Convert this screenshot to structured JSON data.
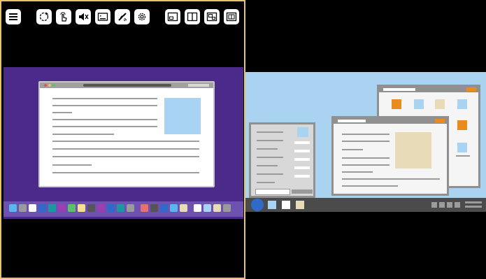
{
  "toolbar": {
    "buttons": [
      {
        "name": "menu",
        "icon": "menu-icon"
      },
      {
        "name": "refresh",
        "icon": "refresh-icon"
      },
      {
        "name": "touch",
        "icon": "touch-icon"
      },
      {
        "name": "mute",
        "icon": "mute-icon"
      },
      {
        "name": "keyboard",
        "icon": "keyboard-icon"
      },
      {
        "name": "disconnect",
        "icon": "disconnect-icon"
      },
      {
        "name": "settings",
        "icon": "gear-icon"
      },
      {
        "name": "view-single",
        "icon": "view-single-icon"
      },
      {
        "name": "view-split",
        "icon": "view-split-icon"
      },
      {
        "name": "view-pip",
        "icon": "view-pip-icon"
      },
      {
        "name": "view-quad",
        "icon": "view-quad-icon"
      }
    ]
  },
  "colors": {
    "active_border": "#e5c46b",
    "mac_desktop": "#4b2a8a",
    "mac_dock": "#6e51b0",
    "win_desktop": "#a9d3f0",
    "win_taskbar": "#4b4b4b",
    "accent_orange": "#e88d1d"
  }
}
